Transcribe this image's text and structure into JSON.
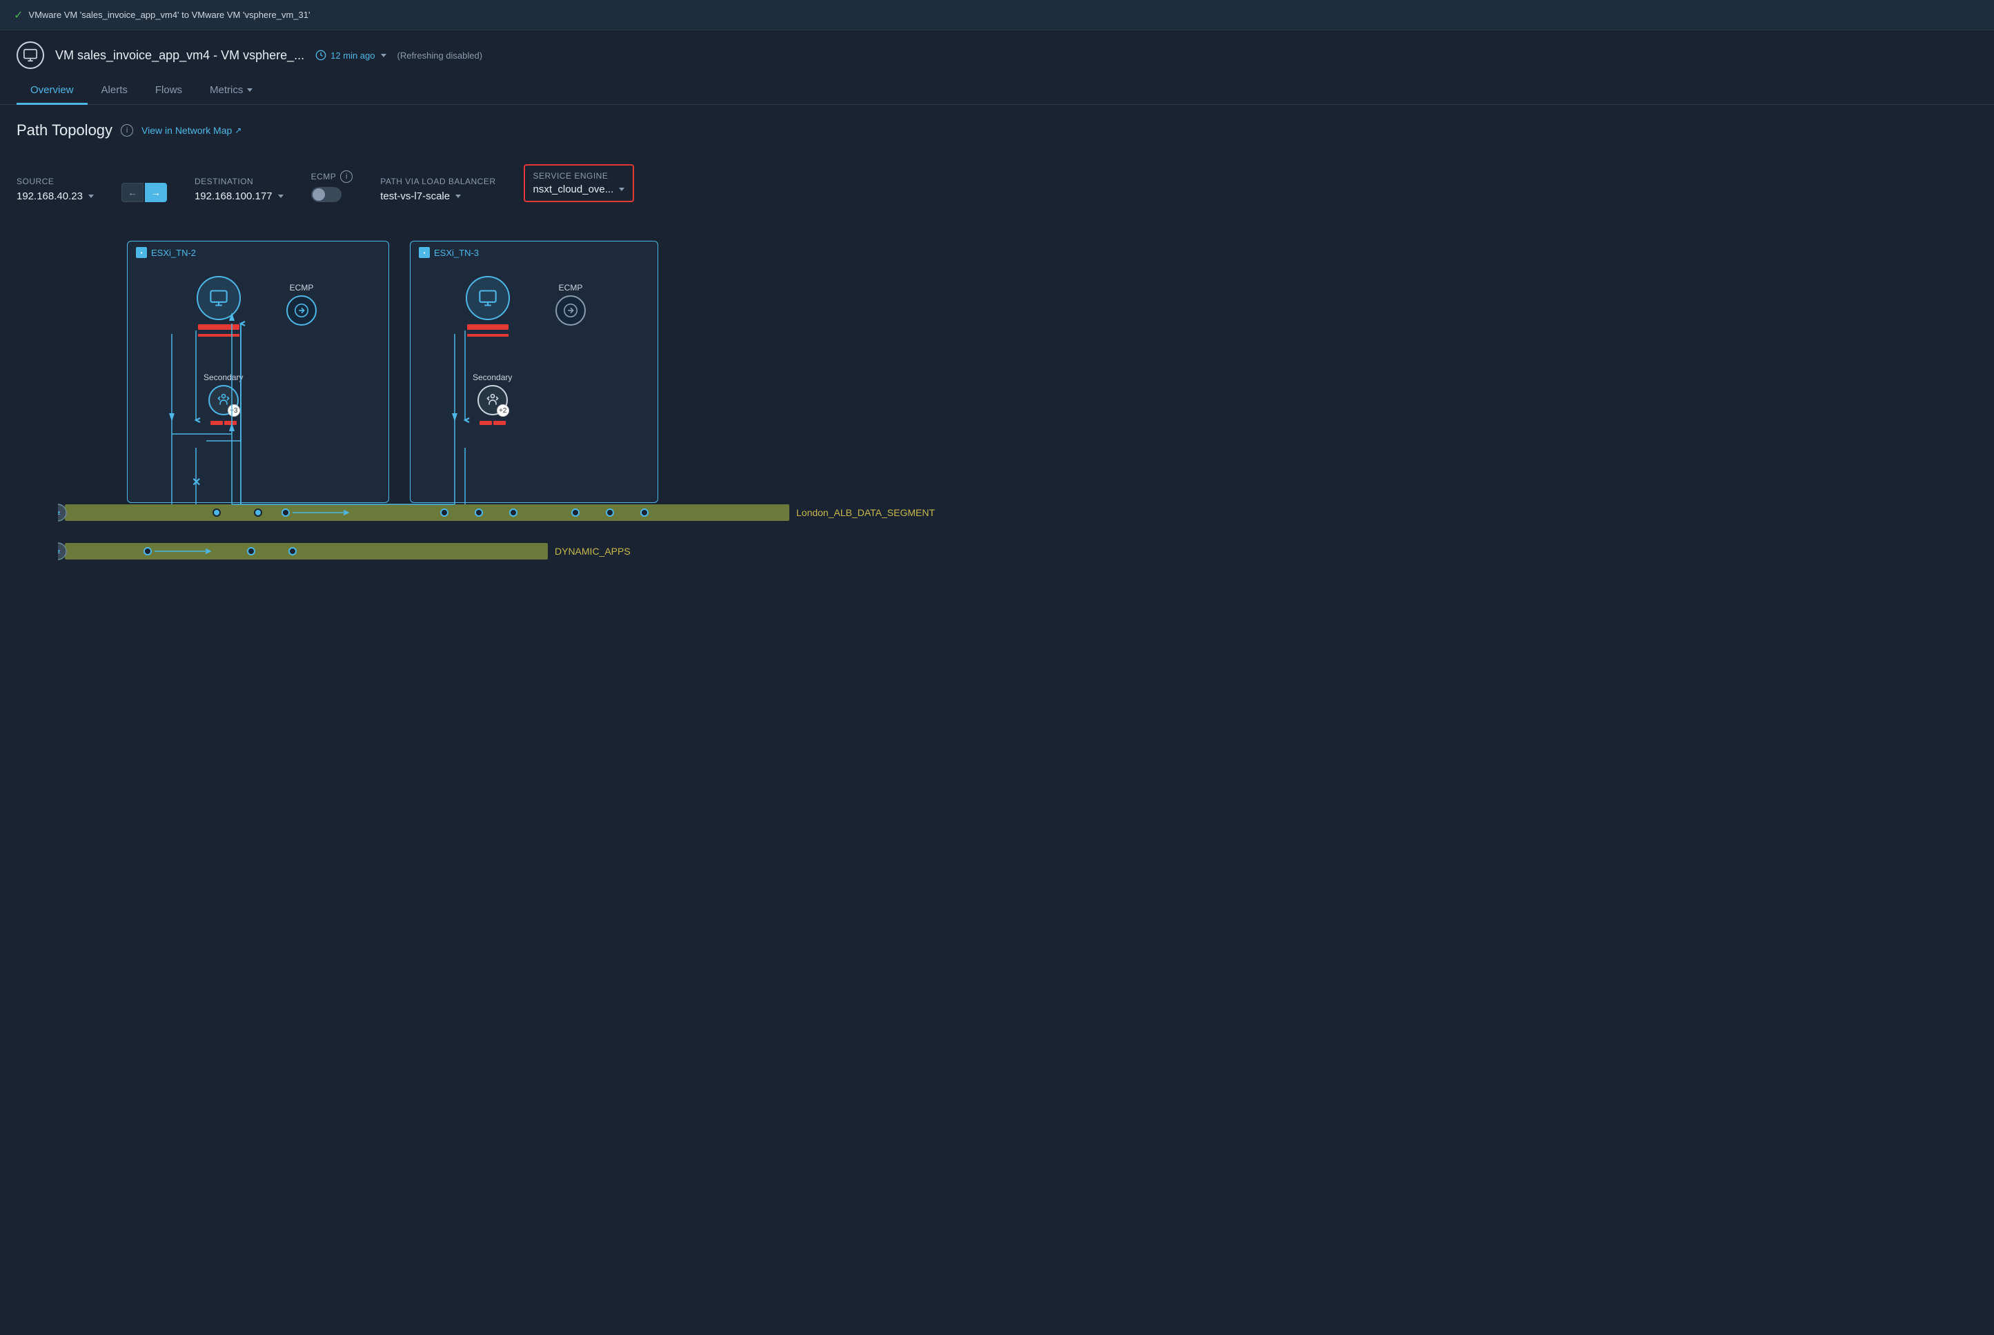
{
  "notification": {
    "text": "VMware VM 'sales_invoice_app_vm4' to VMware VM 'vsphere_vm_31'"
  },
  "header": {
    "vm_icon": "🖥",
    "title": "VM sales_invoice_app_vm4 - VM vsphere_...",
    "time_label": "12 min ago",
    "refreshing_label": "(Refreshing  disabled)"
  },
  "nav": {
    "tabs": [
      {
        "label": "Overview",
        "active": true
      },
      {
        "label": "Alerts",
        "active": false
      },
      {
        "label": "Flows",
        "active": false
      },
      {
        "label": "Metrics",
        "active": false,
        "has_arrow": true
      }
    ]
  },
  "path_topology": {
    "title": "Path Topology",
    "view_network_label": "View in Network Map",
    "source_label": "Source",
    "source_value": "192.168.40.23",
    "destination_label": "Destination",
    "destination_value": "192.168.100.177",
    "ecmp_label": "ECMP",
    "path_via_lb_label": "Path via Load Balancer",
    "path_via_lb_value": "test-vs-l7-scale",
    "service_engine_label": "Service Engine",
    "service_engine_value": "nsxt_cloud_ove...",
    "esxi_tn2_label": "ESXi_TN-2",
    "esxi_tn3_label": "ESXi_TN-3",
    "ecmp_node_label": "ECMP",
    "secondary_label": "Secondary",
    "secondary_badge_tn2": "+3",
    "secondary_badge_tn3": "+2",
    "segment1_label": "London_ALB_DATA_SEGMENT",
    "segment2_label": "DYNAMIC_APPS"
  }
}
